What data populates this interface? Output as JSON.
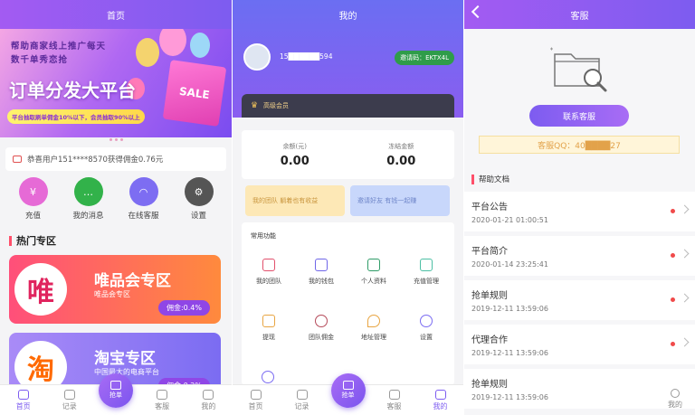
{
  "home": {
    "title": "首页",
    "banner": {
      "small_text": "帮助商家线上推广每天数千单秀恋抢",
      "headline": "订单分发大平台",
      "tag": "平台抽取刷单佣金10%以下，会员抽取90%以上",
      "bag_label": "SALE"
    },
    "notice": "恭喜用户151****8570获得佣金0.76元",
    "quick": [
      {
        "label": "充值",
        "color": "#e66ad6"
      },
      {
        "label": "我的消息",
        "color": "#32b24a"
      },
      {
        "label": "在线客服",
        "color": "#7d6df2"
      },
      {
        "label": "设置",
        "color": "#555555"
      }
    ],
    "section": "热门专区",
    "cards": [
      {
        "logo": "唯",
        "title": "唯品会专区",
        "sub": "唯品会专区",
        "badge": "佣金:0.4%",
        "logo_color": "#e0245e",
        "grad": "linear-gradient(90deg,#ff4f7a,#ff8a3d)"
      },
      {
        "logo": "淘",
        "title": "淘宝专区",
        "sub": "中国最大的电商平台",
        "badge": "佣金:0.2%",
        "logo_color": "#ff6a00",
        "grad": "linear-gradient(90deg,#a98bf7,#7b6cf2)"
      }
    ],
    "tabs": [
      "首页",
      "记录",
      "抢单",
      "客服",
      "我的"
    ]
  },
  "mine": {
    "title": "我的",
    "phone": "15██████594",
    "invite": "邀请码：EKTX4L",
    "vip": "高级会员",
    "balance_label": "余额(元)",
    "balance": "0.00",
    "frozen_label": "冻结金额",
    "frozen": "0.00",
    "promo1": "我的团队 躺着也有收益",
    "promo2": "邀请好友 有钱一起赚",
    "func_title": "常用功能",
    "funcs": [
      {
        "label": "我的团队",
        "color": "#e2506c"
      },
      {
        "label": "我的钱包",
        "color": "#6f66e8"
      },
      {
        "label": "个人资料",
        "color": "#2f9c68"
      },
      {
        "label": "充值管理",
        "color": "#4cbfa4"
      },
      {
        "label": "提现",
        "color": "#e8a542"
      },
      {
        "label": "团队佣金",
        "color": "#b54a5a"
      },
      {
        "label": "地址管理",
        "color": "#e8a542"
      },
      {
        "label": "设置",
        "color": "#7b6cf2"
      }
    ],
    "tabs": [
      "首页",
      "记录",
      "抢单",
      "客服",
      "我的"
    ]
  },
  "service": {
    "title": "客服",
    "button": "联系客服",
    "qq": "客服QQ：40████27",
    "help": "帮助文档",
    "articles": [
      {
        "title": "平台公告",
        "date": "2020-01-21 01:00:51"
      },
      {
        "title": "平台简介",
        "date": "2020-01-14 23:25:41"
      },
      {
        "title": "抢单规则",
        "date": "2019-12-11 13:59:06"
      },
      {
        "title": "代理合作",
        "date": "2019-12-11 13:59:06"
      },
      {
        "title": "抢单规则",
        "date": "2019-12-11 13:59:06"
      }
    ],
    "tab_mine": "我的"
  }
}
